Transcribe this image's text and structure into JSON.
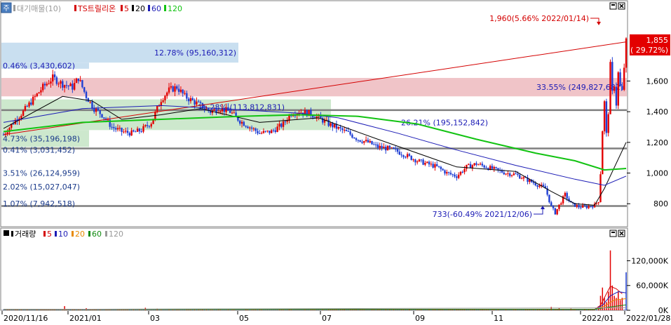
{
  "price_panel": {
    "legend": [
      {
        "label": "대기매물(10)",
        "color": "#9a9a9a"
      },
      {
        "label": "TS트릴리온",
        "color": "#d40000"
      },
      {
        "label": "5",
        "color": "#d40000"
      },
      {
        "label": "20",
        "color": "#000000"
      },
      {
        "label": "60",
        "color": "#1b1bb5"
      },
      {
        "label": "120",
        "color": "#12c312"
      }
    ],
    "corner_button": "주",
    "annotations": {
      "high": "1,960(5.66% 2022/01/14)",
      "low": "733(-60.49% 2021/12/06)"
    },
    "current_price": {
      "value": "1,855",
      "change": "( 29.72%)"
    }
  },
  "volume_panel": {
    "legend": [
      {
        "label": "거래량",
        "color": "#000000"
      },
      {
        "label": "5",
        "color": "#d40000"
      },
      {
        "label": "10",
        "color": "#1b1bb5"
      },
      {
        "label": "20",
        "color": "#e88a00"
      },
      {
        "label": "60",
        "color": "#108a10"
      },
      {
        "label": "120",
        "color": "#9a9a9a"
      }
    ]
  },
  "x_labels": [
    "2020/11/16",
    "2021/01",
    "03",
    "05",
    "07",
    "09",
    "11",
    "2022/01",
    "2022/01/28"
  ],
  "chart_data": [
    {
      "type": "candlestick",
      "name": "price",
      "ylim": [
        650,
        2000
      ],
      "y_ticks": [
        800,
        1000,
        1200,
        1400,
        1600
      ],
      "y_tick_labels": [
        "800",
        "1,000",
        "1,200",
        "1,400",
        "1,600"
      ],
      "horizontal_lines": [
        1410,
        1160,
        785
      ],
      "supply_zones": [
        {
          "label": "12.78% (95,160,312)",
          "low": 1720,
          "high": 1850,
          "color": "#c9dff0"
        },
        {
          "label": "0.46% (3,430,602)",
          "low": 1680,
          "high": 1720,
          "color": "#c9dff0"
        },
        {
          "label": "33.55% (249,827,682)",
          "low": 1500,
          "high": 1620,
          "color": "#f0c4c8"
        },
        {
          "label": "15.28% (113,812,831)",
          "low": 1380,
          "high": 1480,
          "color": "#cde8cd"
        },
        {
          "label": "26.21% (195,152,842)",
          "low": 1280,
          "high": 1380,
          "color": "#cde8cd"
        },
        {
          "label": "4.73% (35,196,198)",
          "low": 1170,
          "high": 1280,
          "color": "#cde8cd"
        },
        {
          "label": "0.41% (3,031,452)",
          "low": 1130,
          "high": 1170,
          "color": "#ffffff"
        },
        {
          "label": "3.51% (26,124,959)",
          "low": 980,
          "high": 1020,
          "color": "#ffffff"
        },
        {
          "label": "2.02% (15,027,047)",
          "low": 890,
          "high": 930,
          "color": "#ffffff"
        },
        {
          "label": "1.07% (7,942,518)",
          "low": 770,
          "high": 830,
          "color": "#ffffff"
        }
      ],
      "anchors": [
        [
          0,
          1250
        ],
        [
          5,
          1330
        ],
        [
          10,
          1400
        ],
        [
          15,
          1480
        ],
        [
          20,
          1560
        ],
        [
          25,
          1620
        ],
        [
          30,
          1580
        ],
        [
          35,
          1560
        ],
        [
          38,
          1620
        ],
        [
          42,
          1500
        ],
        [
          46,
          1420
        ],
        [
          50,
          1380
        ],
        [
          55,
          1300
        ],
        [
          60,
          1270
        ],
        [
          65,
          1260
        ],
        [
          70,
          1280
        ],
        [
          75,
          1330
        ],
        [
          80,
          1480
        ],
        [
          84,
          1540
        ],
        [
          88,
          1560
        ],
        [
          92,
          1500
        ],
        [
          96,
          1470
        ],
        [
          100,
          1440
        ],
        [
          105,
          1400
        ],
        [
          110,
          1420
        ],
        [
          115,
          1400
        ],
        [
          120,
          1340
        ],
        [
          125,
          1300
        ],
        [
          130,
          1260
        ],
        [
          136,
          1270
        ],
        [
          142,
          1320
        ],
        [
          146,
          1390
        ],
        [
          150,
          1400
        ],
        [
          155,
          1390
        ],
        [
          160,
          1360
        ],
        [
          165,
          1320
        ],
        [
          170,
          1290
        ],
        [
          175,
          1260
        ],
        [
          180,
          1220
        ],
        [
          185,
          1200
        ],
        [
          190,
          1170
        ],
        [
          195,
          1160
        ],
        [
          200,
          1140
        ],
        [
          205,
          1110
        ],
        [
          210,
          1080
        ],
        [
          215,
          1060
        ],
        [
          220,
          1040
        ],
        [
          225,
          1000
        ],
        [
          230,
          980
        ],
        [
          235,
          1040
        ],
        [
          240,
          1060
        ],
        [
          245,
          1040
        ],
        [
          250,
          1020
        ],
        [
          255,
          1000
        ],
        [
          260,
          990
        ],
        [
          265,
          960
        ],
        [
          270,
          930
        ],
        [
          275,
          900
        ],
        [
          278,
          780
        ],
        [
          280,
          740
        ],
        [
          282,
          790
        ],
        [
          285,
          860
        ],
        [
          288,
          800
        ],
        [
          292,
          780
        ],
        [
          296,
          780
        ],
        [
          300,
          790
        ],
        [
          302,
          820
        ],
        [
          303,
          1000
        ],
        [
          304,
          1280
        ],
        [
          305,
          1460
        ],
        [
          306,
          1250
        ],
        [
          307,
          1400
        ],
        [
          308,
          1700
        ],
        [
          309,
          1520
        ],
        [
          310,
          1580
        ],
        [
          311,
          1450
        ],
        [
          312,
          1650
        ],
        [
          313,
          1560
        ],
        [
          314,
          1530
        ],
        [
          316,
          1855
        ]
      ],
      "moving_averages": [
        {
          "name": "5",
          "color": "#d40000",
          "points": [
            [
              0,
              1250
            ],
            [
              316,
              1855
            ]
          ]
        },
        {
          "name": "20",
          "color": "#000000",
          "points": [
            [
              0,
              1290
            ],
            [
              30,
              1500
            ],
            [
              45,
              1470
            ],
            [
              60,
              1350
            ],
            [
              80,
              1380
            ],
            [
              100,
              1420
            ],
            [
              130,
              1330
            ],
            [
              160,
              1360
            ],
            [
              190,
              1220
            ],
            [
              230,
              1040
            ],
            [
              260,
              1010
            ],
            [
              278,
              880
            ],
            [
              290,
              800
            ],
            [
              300,
              790
            ],
            [
              305,
              900
            ],
            [
              316,
              1200
            ]
          ]
        },
        {
          "name": "60",
          "color": "#1b1bb5",
          "points": [
            [
              0,
              1330
            ],
            [
              40,
              1420
            ],
            [
              80,
              1440
            ],
            [
              110,
              1420
            ],
            [
              150,
              1390
            ],
            [
              170,
              1360
            ],
            [
              200,
              1260
            ],
            [
              230,
              1150
            ],
            [
              260,
              1050
            ],
            [
              290,
              960
            ],
            [
              305,
              920
            ],
            [
              316,
              980
            ]
          ]
        },
        {
          "name": "120",
          "color": "#12c312",
          "points": [
            [
              0,
              1270
            ],
            [
              40,
              1330
            ],
            [
              80,
              1350
            ],
            [
              120,
              1370
            ],
            [
              150,
              1380
            ],
            [
              180,
              1370
            ],
            [
              210,
              1320
            ],
            [
              240,
              1220
            ],
            [
              270,
              1130
            ],
            [
              290,
              1080
            ],
            [
              305,
              1020
            ],
            [
              316,
              1030
            ]
          ]
        }
      ]
    },
    {
      "type": "bar",
      "name": "volume",
      "ylim": [
        0,
        165000
      ],
      "y_ticks": [
        0,
        60000,
        120000
      ],
      "y_tick_labels": [
        "0K",
        "60,000K",
        "120,000K"
      ],
      "spikes": [
        {
          "x": 31,
          "value": 10000
        },
        {
          "x": 42,
          "value": 5000
        },
        {
          "x": 72,
          "value": 6000
        },
        {
          "x": 78,
          "value": 4000
        },
        {
          "x": 101,
          "value": 3000
        },
        {
          "x": 123,
          "value": 3000
        },
        {
          "x": 145,
          "value": 3000
        },
        {
          "x": 173,
          "value": 2000
        },
        {
          "x": 206,
          "value": 2000
        },
        {
          "x": 243,
          "value": 2000
        },
        {
          "x": 276,
          "value": 2000
        },
        {
          "x": 278,
          "value": 8000
        },
        {
          "x": 282,
          "value": 5000
        },
        {
          "x": 288,
          "value": 4000
        },
        {
          "x": 295,
          "value": 3000
        },
        {
          "x": 302,
          "value": 6000
        },
        {
          "x": 303,
          "value": 35000
        },
        {
          "x": 304,
          "value": 55000
        },
        {
          "x": 305,
          "value": 30000
        },
        {
          "x": 306,
          "value": 20000
        },
        {
          "x": 307,
          "value": 45000
        },
        {
          "x": 308,
          "value": 145000
        },
        {
          "x": 309,
          "value": 60000
        },
        {
          "x": 310,
          "value": 35000
        },
        {
          "x": 311,
          "value": 30000
        },
        {
          "x": 312,
          "value": 45000
        },
        {
          "x": 313,
          "value": 25000
        },
        {
          "x": 314,
          "value": 30000
        },
        {
          "x": 316,
          "value": 92000
        }
      ],
      "moving_averages": [
        {
          "name": "5",
          "color": "#d40000",
          "points": [
            [
              0,
              2000
            ],
            [
              300,
              2000
            ],
            [
              303,
              12000
            ],
            [
              306,
              40000
            ],
            [
              308,
              58000
            ],
            [
              311,
              52000
            ],
            [
              314,
              40000
            ]
          ]
        },
        {
          "name": "10",
          "color": "#1b1bb5",
          "points": [
            [
              0,
              2000
            ],
            [
              300,
              2000
            ],
            [
              304,
              12000
            ],
            [
              308,
              35000
            ],
            [
              312,
              45000
            ],
            [
              316,
              42000
            ]
          ]
        },
        {
          "name": "20",
          "color": "#e88a00",
          "points": [
            [
              0,
              2000
            ],
            [
              300,
              2000
            ],
            [
              305,
              10000
            ],
            [
              310,
              25000
            ],
            [
              316,
              28000
            ]
          ]
        },
        {
          "name": "60",
          "color": "#108a10",
          "points": [
            [
              0,
              2000
            ],
            [
              300,
              2000
            ],
            [
              308,
              8000
            ],
            [
              316,
              13000
            ]
          ]
        },
        {
          "name": "120",
          "color": "#9a9a9a",
          "points": [
            [
              0,
              2000
            ],
            [
              316,
              6000
            ]
          ]
        }
      ]
    }
  ]
}
